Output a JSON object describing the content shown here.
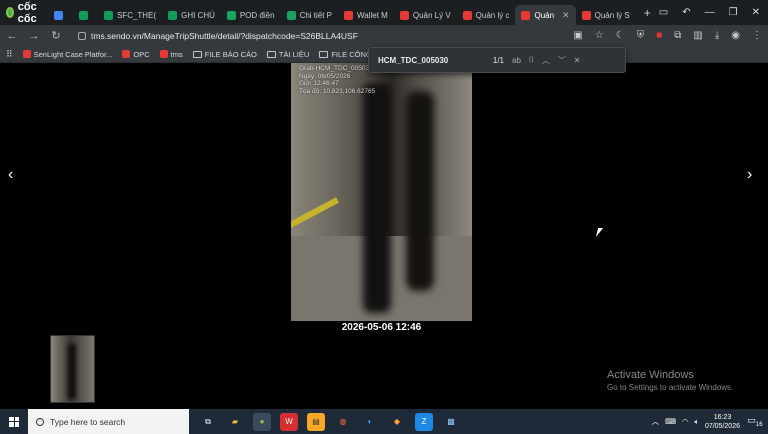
{
  "browser": {
    "brand": "cốc cốc",
    "tabs": [
      {
        "label": "",
        "color": "#4285f4",
        "active": false
      },
      {
        "label": "",
        "color": "#0f9d58",
        "active": false
      },
      {
        "label": "SFC_THE(",
        "color": "#0f9d58",
        "active": false
      },
      {
        "label": "GHI CHÚ",
        "color": "#0f9d58",
        "active": false
      },
      {
        "label": "POD điền",
        "color": "#1aa260",
        "active": false
      },
      {
        "label": "Chi tiết P",
        "color": "#1aa260",
        "active": false
      },
      {
        "label": "Wallet M",
        "color": "#e53935",
        "active": false
      },
      {
        "label": "Quản Lý V",
        "color": "#e53935",
        "active": false
      },
      {
        "label": "Quản lý c",
        "color": "#e53935",
        "active": false
      },
      {
        "label": "Quản",
        "color": "#e53935",
        "active": true
      },
      {
        "label": "Quản lý S",
        "color": "#e53935",
        "active": false
      }
    ],
    "new_tab": "+",
    "url": "tms.sendo.vn/ManageTripShuttle/detail/?dispatchcode=S26BLLA4USF",
    "bookmarks": [
      {
        "label": "SenLight Case Platfor...",
        "kind": "site"
      },
      {
        "label": "OPC",
        "kind": "site"
      },
      {
        "label": "tms",
        "kind": "site"
      },
      {
        "label": "FILE BÁO CÁO",
        "kind": "folder"
      },
      {
        "label": "TÀI LIỆU",
        "kind": "folder"
      },
      {
        "label": "FILE CÔNG VIỆC",
        "kind": "folder"
      }
    ]
  },
  "find_bar": {
    "query": "HCM_TDC_005030",
    "count": "1/1",
    "match_case": "ab",
    "whole_word": "⌷"
  },
  "viewer": {
    "photo_meta": [
      "Grab-HCM_TDC_005030",
      "Ngày: 06/05/2026",
      "Giờ: 12:46:47",
      "Tọa độ: 10.823,106.62765"
    ],
    "caption": "2026-05-06 12:46",
    "prev": "‹",
    "next": "›"
  },
  "activation": {
    "title": "Activate Windows",
    "subtitle": "Go to Settings to activate Windows."
  },
  "taskbar": {
    "search_placeholder": "Type here to search",
    "time": "16:23",
    "date": "07/05/2026",
    "notif_count": "16"
  }
}
